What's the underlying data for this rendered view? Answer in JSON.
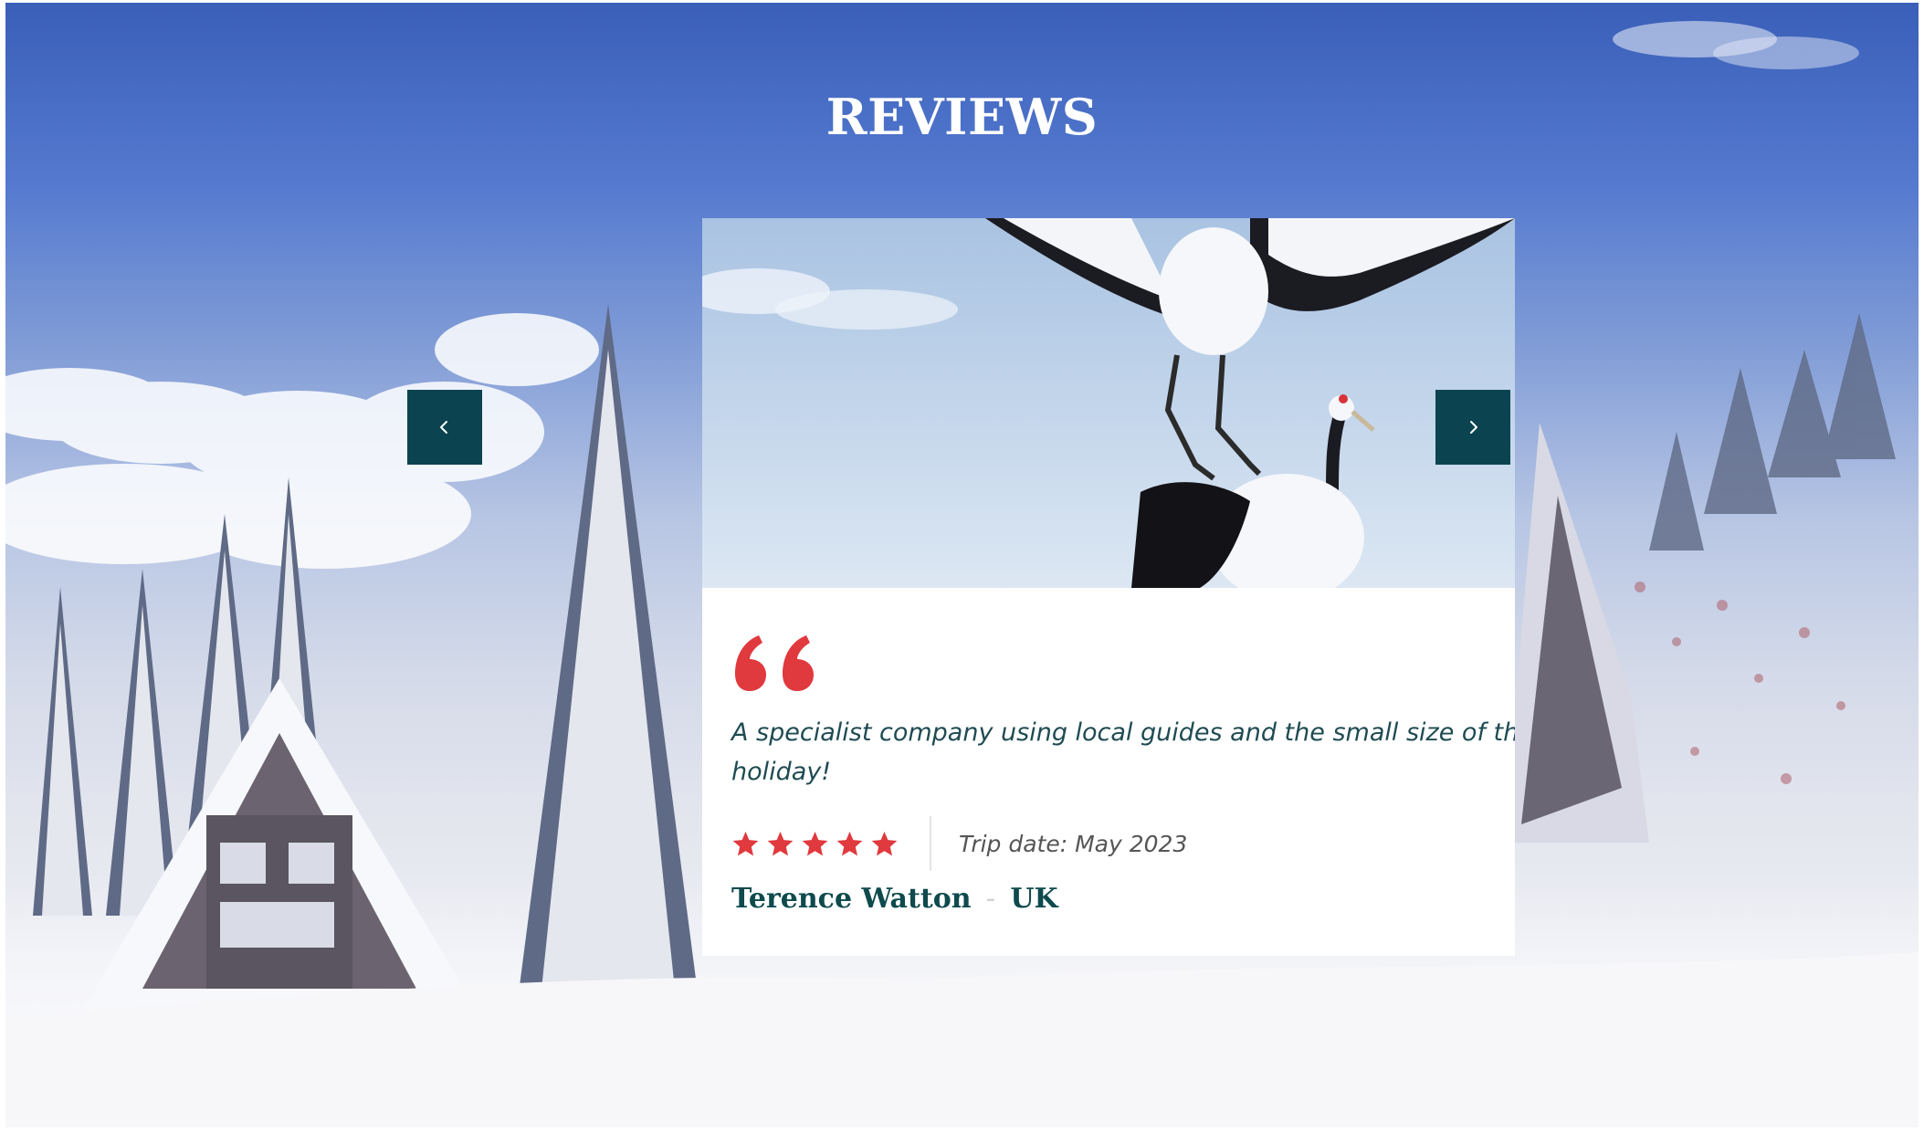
{
  "section": {
    "title": "REVIEWS"
  },
  "carousel": {
    "prev_icon": "chevron-left-icon",
    "next_icon": "chevron-right-icon"
  },
  "review": {
    "photo": "red-crowned-cranes-photo",
    "quote_icon": "quote-icon",
    "text_line_1": "A specialist company using local guides and the small size of the gro",
    "text_line_2": "holiday!",
    "rating": 5,
    "rating_max": 5,
    "trip_date": "Trip date: May 2023",
    "author_name": "Terence Watton",
    "author_separator": "-",
    "author_country": "UK"
  },
  "colors": {
    "accent_red": "#e0393e",
    "brand_teal": "#0b4450",
    "text_teal": "#1f4b52"
  }
}
